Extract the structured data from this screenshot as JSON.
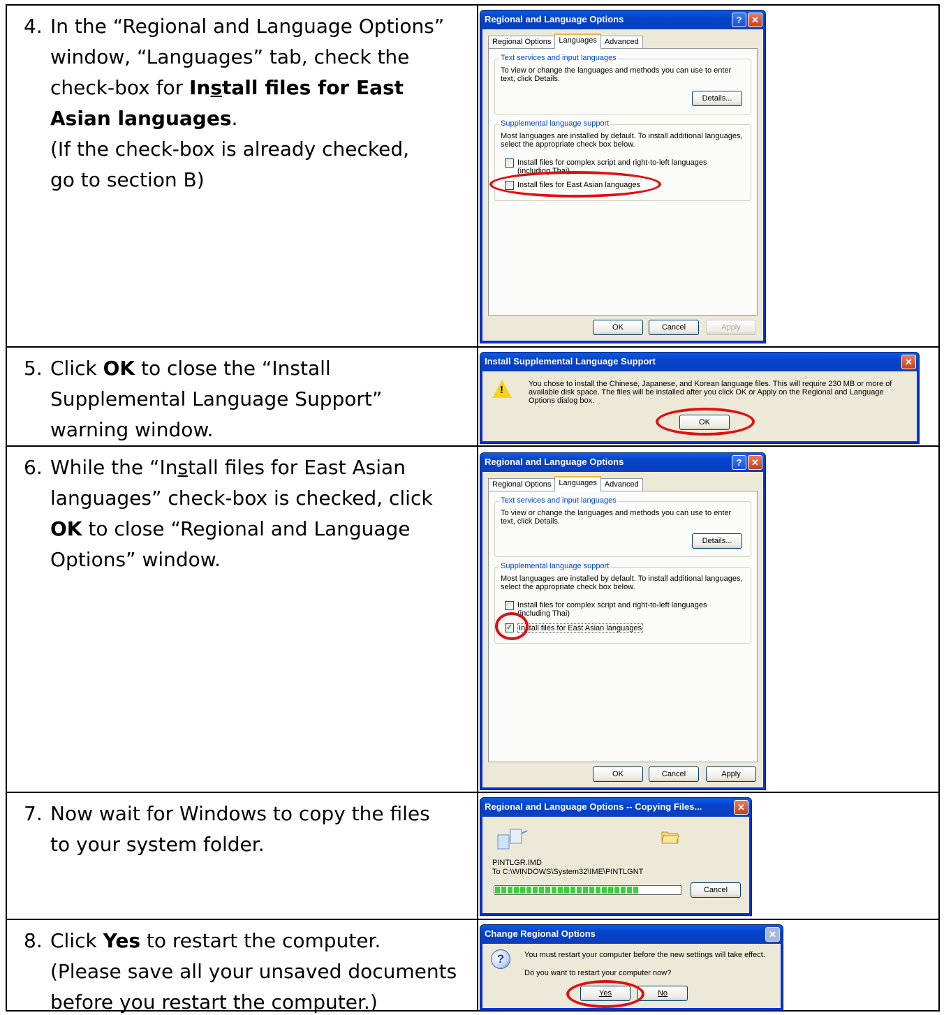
{
  "steps": [
    {
      "num": "4.",
      "lines": [
        "In the “Regional and Language Options”",
        "window, “Languages” tab, check the",
        "check-box for",
        "Asian languages",
        "(If the check-box is already checked,",
        "go to section B)"
      ],
      "bold_a": "In",
      "bold_u": "s",
      "bold_b": "tall files for East",
      "period": "."
    },
    {
      "num": "5.",
      "pre": "Click ",
      "bold": "OK",
      "post": " to close the “Install",
      "l2": "Supplemental Language Support”",
      "l3": "warning window."
    },
    {
      "num": "6.",
      "l1a": "While the “In",
      "l1u": "s",
      "l1b": "tall files for East Asian",
      "l2": "languages” check-box is checked, click",
      "bold": "OK",
      "l3": " to close “Regional and Language",
      "l4": "Options” window."
    },
    {
      "num": "7.",
      "l1": "Now wait for Windows to copy the files",
      "l2": "to your system folder."
    },
    {
      "num": "8.",
      "pre": "Click ",
      "bold": "Yes",
      "post": " to restart the computer.",
      "l2": "(Please save all your unsaved documents",
      "l3": "before you restart the computer.)"
    }
  ],
  "dlg_regional": {
    "title": "Regional and Language Options",
    "tabs": [
      "Regional Options",
      "Languages",
      "Advanced"
    ],
    "group1_label": "Text services and input languages",
    "group1_text": "To view or change the languages and methods you can use to enter text, click Details.",
    "details": "Details...",
    "group2_label": "Supplemental language support",
    "group2_text": "Most languages are installed by default. To install additional languages, select the appropriate check box below.",
    "cb1": "Install files for complex script and right-to-left languages (including Thai)",
    "cb2": "Install files for East Asian languages",
    "ok": "OK",
    "cancel": "Cancel",
    "apply": "Apply",
    "help_glyph": "?",
    "close_glyph": "✕"
  },
  "dlg_install": {
    "title": "Install Supplemental Language Support",
    "message": "You chose to install the Chinese, Japanese, and Korean language files. This will require 230 MB or more of available disk space. The files will be installed after you click OK or Apply on the Regional and Language Options dialog box.",
    "ok": "OK",
    "warn_glyph": "!"
  },
  "dlg_copy": {
    "title": "Regional and Language Options -- Copying Files...",
    "file": "PINTLGR.IMD",
    "dest": "To C:\\WINDOWS\\System32\\IME\\PINTLGNT",
    "cancel": "Cancel",
    "progress": 0.78
  },
  "dlg_restart": {
    "title": "Change Regional Options",
    "line1": "You must restart your computer before the new settings will take effect.",
    "line2": "Do you want to restart your computer now?",
    "yes": "Yes",
    "no": "No",
    "q_glyph": "?"
  }
}
